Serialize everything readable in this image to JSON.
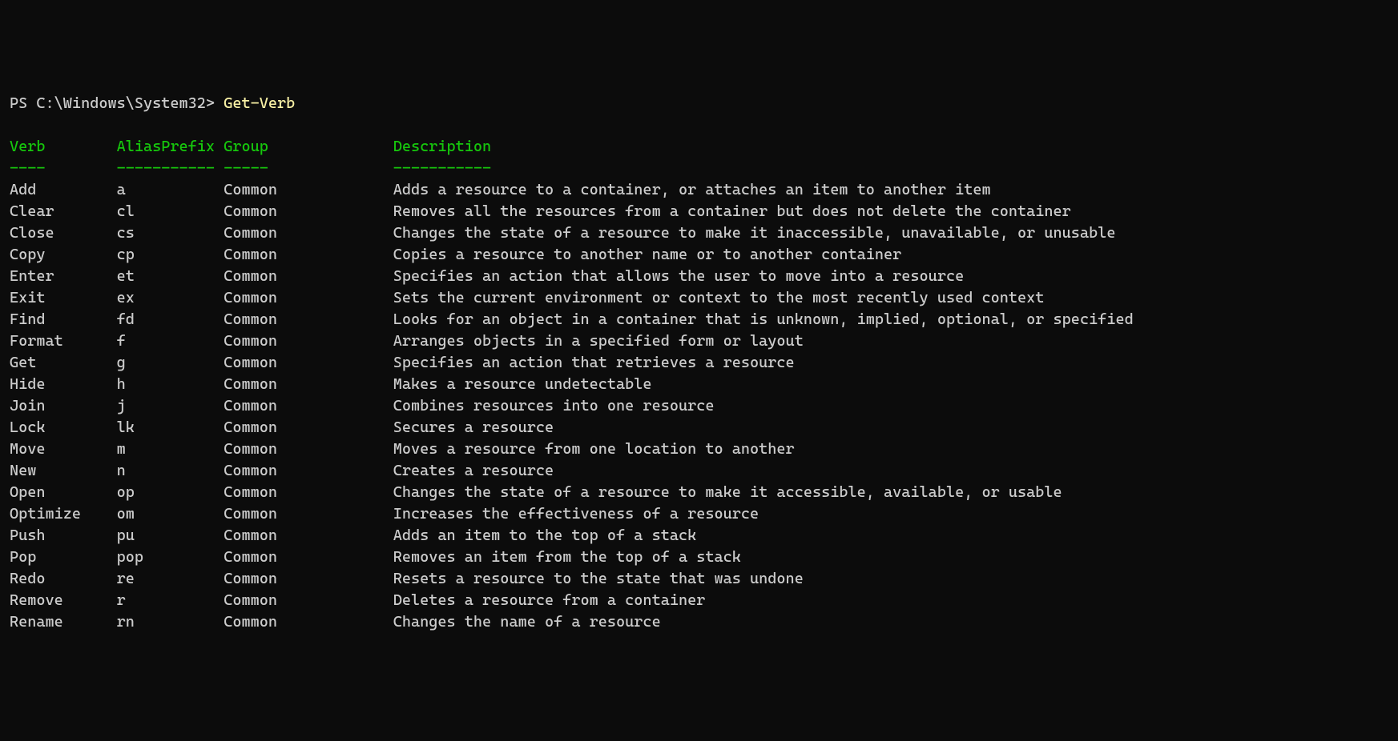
{
  "prompt": {
    "prefix": "PS C:\\Windows\\System32> ",
    "command": "Get-Verb"
  },
  "headers": {
    "verb": "Verb",
    "aliasPrefix": "AliasPrefix",
    "group": "Group",
    "description": "Description"
  },
  "separators": {
    "verb": "----",
    "aliasPrefix": "-----------",
    "group": "-----",
    "description": "-----------"
  },
  "columnWidths": {
    "verb": 12,
    "aliasPrefix": 12,
    "group": 19,
    "description": 0
  },
  "rows": [
    {
      "verb": "Add",
      "aliasPrefix": "a",
      "group": "Common",
      "description": "Adds a resource to a container, or attaches an item to another item"
    },
    {
      "verb": "Clear",
      "aliasPrefix": "cl",
      "group": "Common",
      "description": "Removes all the resources from a container but does not delete the container"
    },
    {
      "verb": "Close",
      "aliasPrefix": "cs",
      "group": "Common",
      "description": "Changes the state of a resource to make it inaccessible, unavailable, or unusable"
    },
    {
      "verb": "Copy",
      "aliasPrefix": "cp",
      "group": "Common",
      "description": "Copies a resource to another name or to another container"
    },
    {
      "verb": "Enter",
      "aliasPrefix": "et",
      "group": "Common",
      "description": "Specifies an action that allows the user to move into a resource"
    },
    {
      "verb": "Exit",
      "aliasPrefix": "ex",
      "group": "Common",
      "description": "Sets the current environment or context to the most recently used context"
    },
    {
      "verb": "Find",
      "aliasPrefix": "fd",
      "group": "Common",
      "description": "Looks for an object in a container that is unknown, implied, optional, or specified"
    },
    {
      "verb": "Format",
      "aliasPrefix": "f",
      "group": "Common",
      "description": "Arranges objects in a specified form or layout"
    },
    {
      "verb": "Get",
      "aliasPrefix": "g",
      "group": "Common",
      "description": "Specifies an action that retrieves a resource"
    },
    {
      "verb": "Hide",
      "aliasPrefix": "h",
      "group": "Common",
      "description": "Makes a resource undetectable"
    },
    {
      "verb": "Join",
      "aliasPrefix": "j",
      "group": "Common",
      "description": "Combines resources into one resource"
    },
    {
      "verb": "Lock",
      "aliasPrefix": "lk",
      "group": "Common",
      "description": "Secures a resource"
    },
    {
      "verb": "Move",
      "aliasPrefix": "m",
      "group": "Common",
      "description": "Moves a resource from one location to another"
    },
    {
      "verb": "New",
      "aliasPrefix": "n",
      "group": "Common",
      "description": "Creates a resource"
    },
    {
      "verb": "Open",
      "aliasPrefix": "op",
      "group": "Common",
      "description": "Changes the state of a resource to make it accessible, available, or usable"
    },
    {
      "verb": "Optimize",
      "aliasPrefix": "om",
      "group": "Common",
      "description": "Increases the effectiveness of a resource"
    },
    {
      "verb": "Push",
      "aliasPrefix": "pu",
      "group": "Common",
      "description": "Adds an item to the top of a stack"
    },
    {
      "verb": "Pop",
      "aliasPrefix": "pop",
      "group": "Common",
      "description": "Removes an item from the top of a stack"
    },
    {
      "verb": "Redo",
      "aliasPrefix": "re",
      "group": "Common",
      "description": "Resets a resource to the state that was undone"
    },
    {
      "verb": "Remove",
      "aliasPrefix": "r",
      "group": "Common",
      "description": "Deletes a resource from a container"
    },
    {
      "verb": "Rename",
      "aliasPrefix": "rn",
      "group": "Common",
      "description": "Changes the name of a resource"
    }
  ]
}
